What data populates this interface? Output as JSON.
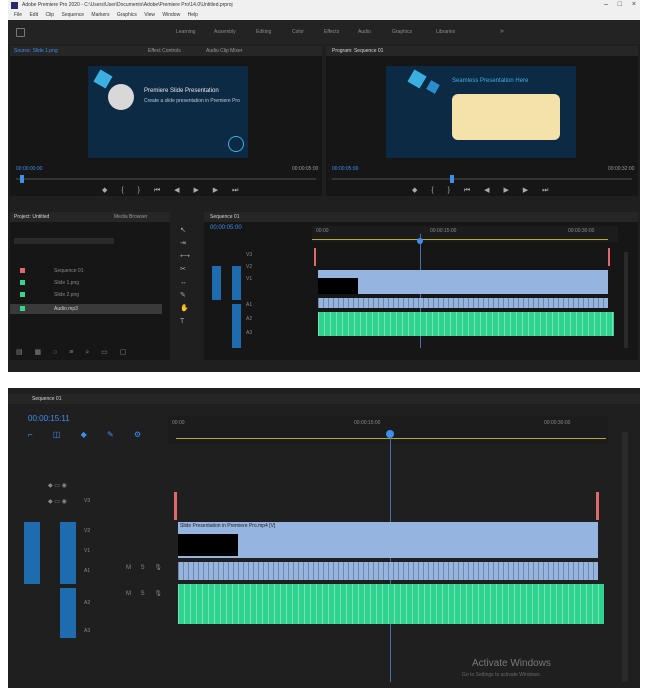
{
  "app": {
    "title": "Adobe Premiere Pro 2020 - C:\\Users\\User\\Documents\\Adobe\\Premiere Pro\\14.0\\Untitled.prproj",
    "menu": [
      "File",
      "Edit",
      "Clip",
      "Sequence",
      "Markers",
      "Graphics",
      "View",
      "Window",
      "Help"
    ],
    "workspaces": [
      "Learning",
      "Assembly",
      "Editing",
      "Color",
      "Effects",
      "Audio",
      "Graphics",
      "Libraries"
    ]
  },
  "source_monitor": {
    "tab": "Source: Slide 1.png",
    "tab2": "Effect Controls",
    "tab3": "Audio Clip Mixer",
    "slide_title": "Premiere Slide Presentation",
    "slide_sub": "Create a slide presentation in Premiere Pro",
    "timecode": "00:00:00:00",
    "timecode_end": "00:00:05:00"
  },
  "program_monitor": {
    "tab": "Program: Sequence 01",
    "slide_title": "Seamless Presentation Here",
    "timecode": "00:00:05:00",
    "timecode_end": "00:00:32:00"
  },
  "project_panel": {
    "tab": "Project: Untitled",
    "tab2": "Media Browser",
    "items": [
      "Sequence 01",
      "Slide 1.png",
      "Slide 2.png",
      "Audio.mp3"
    ]
  },
  "timeline_top": {
    "tab": "Sequence 01",
    "timecode": "00:00:05:00",
    "ruler": [
      "00:00",
      "00:00:15:00",
      "00:00:30:00"
    ],
    "tracks": [
      "V3",
      "V2",
      "V1",
      "A1",
      "A2",
      "A3"
    ]
  },
  "timeline_bottom": {
    "tab": "Sequence 01",
    "timecode": "00:00:15:11",
    "ruler": [
      "00:00",
      "00:00:15:00",
      "00:00:30:00"
    ],
    "tracks": [
      "V3",
      "V2",
      "V1",
      "A1",
      "A2",
      "A3"
    ],
    "clip_label": "Slide Presentation in Premiere Pro.mp4 [V]"
  },
  "watermark": {
    "line1": "Activate Windows",
    "line2": "Go to Settings to activate Windows."
  },
  "colors": {
    "video_clip": "#95b4e0",
    "audio_clip": "#2fd38f",
    "accent": "#3d8ff0",
    "bg": "#1f1f1f"
  }
}
